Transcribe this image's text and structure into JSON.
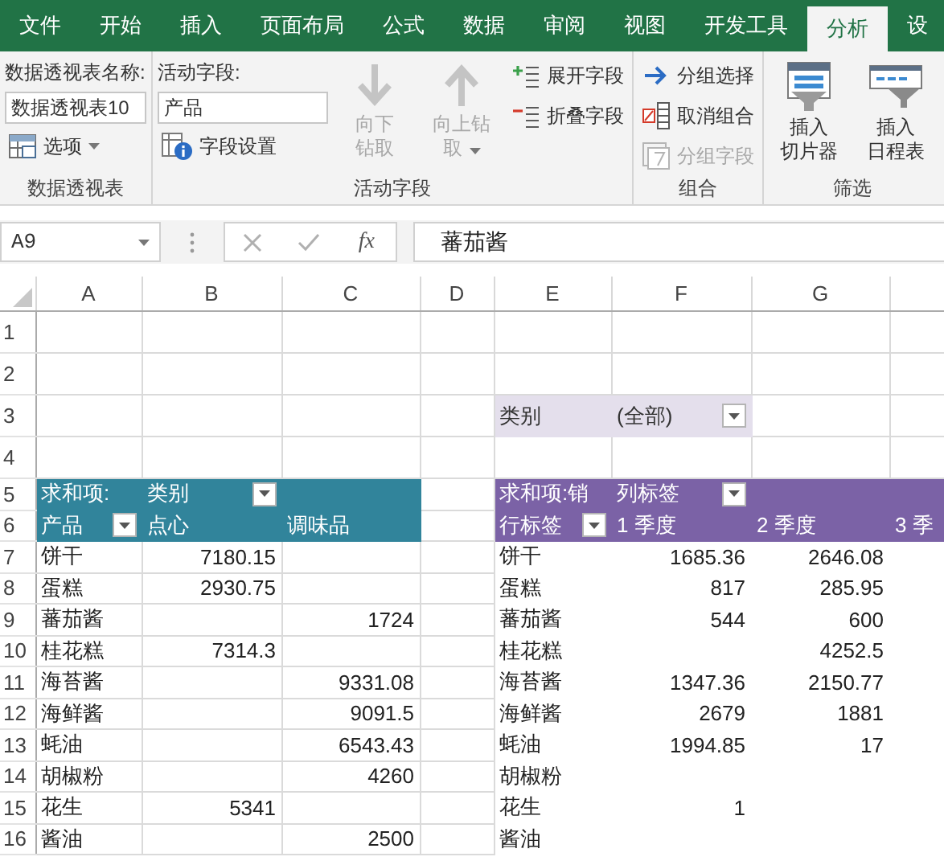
{
  "ribbon_tabs": [
    {
      "label": "文件",
      "selected": false
    },
    {
      "label": "开始",
      "selected": false
    },
    {
      "label": "插入",
      "selected": false
    },
    {
      "label": "页面布局",
      "selected": false
    },
    {
      "label": "公式",
      "selected": false
    },
    {
      "label": "数据",
      "selected": false
    },
    {
      "label": "审阅",
      "selected": false
    },
    {
      "label": "视图",
      "selected": false
    },
    {
      "label": "开发工具",
      "selected": false
    },
    {
      "label": "分析",
      "selected": true
    },
    {
      "label": "设",
      "selected": false
    }
  ],
  "ribbon_groups": [
    {
      "label": "数据透视表",
      "columns": [
        [
          {
            "kind": "caption",
            "text": "数据透视表名称:"
          },
          {
            "kind": "input",
            "value": "数据透视表10"
          },
          {
            "kind": "small-button",
            "label": "选项",
            "menu": true,
            "disabled": false
          }
        ]
      ]
    },
    {
      "label": "活动字段",
      "columns": [
        [
          {
            "kind": "caption",
            "text": "活动字段:"
          },
          {
            "kind": "input",
            "value": "产品"
          },
          {
            "kind": "small-button",
            "label": "字段设置",
            "menu": false,
            "disabled": false
          }
        ],
        [
          {
            "kind": "large-button",
            "label": "向下钻取",
            "menu": false,
            "disabled": true
          }
        ],
        [
          {
            "kind": "large-button",
            "label": "向上钻取",
            "menu": true,
            "disabled": true
          }
        ],
        [
          {
            "kind": "small-button",
            "label": "展开字段",
            "menu": false,
            "disabled": false
          },
          {
            "kind": "small-button",
            "label": "折叠字段",
            "menu": false,
            "disabled": false
          }
        ]
      ]
    },
    {
      "label": "组合",
      "columns": [
        [
          {
            "kind": "small-button",
            "label": "分组选择",
            "menu": false,
            "disabled": false
          },
          {
            "kind": "small-button",
            "label": "取消组合",
            "menu": false,
            "disabled": false
          },
          {
            "kind": "small-button",
            "label": "分组字段",
            "menu": false,
            "disabled": true
          }
        ]
      ]
    },
    {
      "label": "筛选",
      "columns": [
        [
          {
            "kind": "large-button",
            "label": "插入切片器",
            "menu": false,
            "disabled": false
          }
        ],
        [
          {
            "kind": "large-button",
            "label": "插入日程表",
            "menu": false,
            "disabled": false
          }
        ]
      ]
    }
  ],
  "formula_bar": {
    "name_box": "A9",
    "function_label": "fx",
    "formula": "蕃茄酱"
  },
  "sheet": {
    "columns": [
      "A",
      "B",
      "C",
      "D",
      "E",
      "F",
      "G"
    ],
    "rows": [
      {
        "number": "1"
      },
      {
        "number": "2"
      },
      {
        "number": "3",
        "cells": {
          "E": "类别",
          "F": "(全部)"
        }
      },
      {
        "number": "4"
      },
      {
        "number": "5",
        "cells": {
          "A": "求和项:",
          "B": "类别",
          "E": "求和项:销",
          "F": "列标签"
        }
      },
      {
        "number": "6",
        "cells": {
          "A": "产品",
          "B": "点心",
          "C": "调味品",
          "E": "行标签",
          "F": "1 季度",
          "G": "2 季度",
          "H": "3 季"
        }
      },
      {
        "number": "7",
        "cells": {
          "A": "饼干",
          "B": "7180.15",
          "E": "饼干",
          "F": "1685.36",
          "G": "2646.08"
        }
      },
      {
        "number": "8",
        "cells": {
          "A": "蛋糕",
          "B": "2930.75",
          "E": "蛋糕",
          "F": "817",
          "G": "285.95"
        }
      },
      {
        "number": "9",
        "cells": {
          "A": "蕃茄酱",
          "C": "1724",
          "E": "蕃茄酱",
          "F": "544",
          "G": "600"
        }
      },
      {
        "number": "10",
        "cells": {
          "A": "桂花糕",
          "B": "7314.3",
          "E": "桂花糕",
          "G": "4252.5"
        }
      },
      {
        "number": "11",
        "cells": {
          "A": "海苔酱",
          "C": "9331.08",
          "E": "海苔酱",
          "F": "1347.36",
          "G": "2150.77"
        }
      },
      {
        "number": "12",
        "cells": {
          "A": "海鲜酱",
          "C": "9091.5",
          "E": "海鲜酱",
          "F": "2679",
          "G": "1881"
        }
      },
      {
        "number": "13",
        "cells": {
          "A": "蚝油",
          "C": "6543.43",
          "E": "蚝油",
          "F": "1994.85",
          "G": "17"
        }
      },
      {
        "number": "14",
        "cells": {
          "A": "胡椒粉",
          "C": "4260",
          "E": "胡椒粉"
        }
      },
      {
        "number": "15",
        "cells": {
          "A": "花生",
          "B": "5341",
          "E": "花生",
          "F": "1"
        }
      },
      {
        "number": "16",
        "cells": {
          "A": "酱油",
          "C": "2500",
          "E": "酱油"
        }
      }
    ]
  }
}
